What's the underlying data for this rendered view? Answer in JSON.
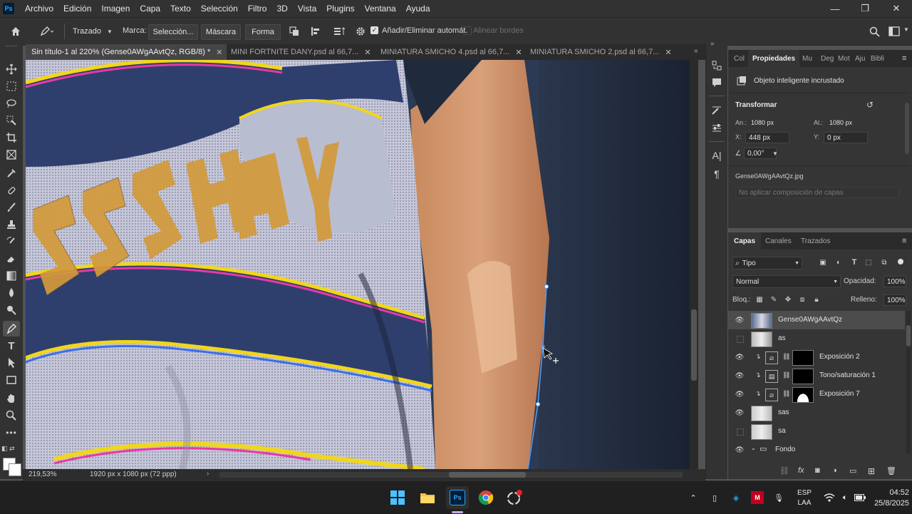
{
  "app": {
    "logo": "Ps"
  },
  "menu": [
    "Archivo",
    "Edición",
    "Imagen",
    "Capa",
    "Texto",
    "Selección",
    "Filtro",
    "3D",
    "Vista",
    "Plugins",
    "Ventana",
    "Ayuda"
  ],
  "window_controls": {
    "minimize": "—",
    "maximize": "❐",
    "close": "✕"
  },
  "options": {
    "mode_value": "Trazado",
    "marca_label": "Marca:",
    "seleccion_label": "Selección...",
    "mascara_label": "Máscara",
    "forma_label": "Forma",
    "auto_add_label": "Añadir/Eliminar automát.",
    "auto_add_checked": true,
    "align_edges_label": "Alinear bordes",
    "align_edges_checked": false
  },
  "tabs": [
    {
      "label": "Sin título-1 al 220% (Gense0AWgAAvtQz, RGB/8) *",
      "active": true
    },
    {
      "label": "MINI FORTNITE DANY.psd al 66,7...",
      "active": false
    },
    {
      "label": "MINIATURA SMICHO 4.psd al 66,7...",
      "active": false
    },
    {
      "label": "MINIATURA SMICHO 2.psd al 66,7...",
      "active": false
    }
  ],
  "status": {
    "zoom": "219,53%",
    "doc_size": "1920 px x 1080 px (72 ppp)"
  },
  "properties": {
    "tabs": [
      "Col",
      "Propiedades",
      "Mu",
      "Deg",
      "Mot",
      "Aju",
      "Bibli"
    ],
    "active_tab": "Propiedades",
    "object_type": "Objeto inteligente incrustado",
    "section_title": "Transformar",
    "an_label": "An.:",
    "an_value": "1080 px",
    "al_label": "Al.:",
    "al_value": "1080 px",
    "x_label": "X:",
    "x_value": "448 px",
    "y_label": "Y:",
    "y_value": "0 px",
    "angle_value": "0,00°",
    "filename": "Gense0AWgAAvtQz.jpg",
    "layer_comp": "No aplicar composición de capas"
  },
  "layers_panel": {
    "tabs": [
      "Capas",
      "Canales",
      "Trazados"
    ],
    "active_tab": "Capas",
    "filter_value": "Tipo",
    "blend_mode": "Normal",
    "opacity_label": "Opacidad:",
    "opacity_value": "100%",
    "lock_label": "Bloq.:",
    "fill_label": "Relleno:",
    "fill_value": "100%",
    "layers": [
      {
        "name": "Gense0AWgAAvtQz",
        "visible": true,
        "selected": true,
        "kind": "smart"
      },
      {
        "name": "as",
        "visible": false,
        "selected": false,
        "kind": "smart"
      },
      {
        "name": "Exposición 2",
        "visible": true,
        "selected": false,
        "kind": "adjust"
      },
      {
        "name": "Tono/saturación 1",
        "visible": true,
        "selected": false,
        "kind": "adjust"
      },
      {
        "name": "Exposición 7",
        "visible": true,
        "selected": false,
        "kind": "adjust"
      },
      {
        "name": "sas",
        "visible": true,
        "selected": false,
        "kind": "smart"
      },
      {
        "name": "sa",
        "visible": false,
        "selected": false,
        "kind": "smart"
      },
      {
        "name": "Fondo",
        "visible": true,
        "selected": false,
        "kind": "group"
      }
    ]
  },
  "taskbar": {
    "lang_line1": "ESP",
    "lang_line2": "LAA",
    "time": "04:52",
    "date": "25/8/2025"
  }
}
